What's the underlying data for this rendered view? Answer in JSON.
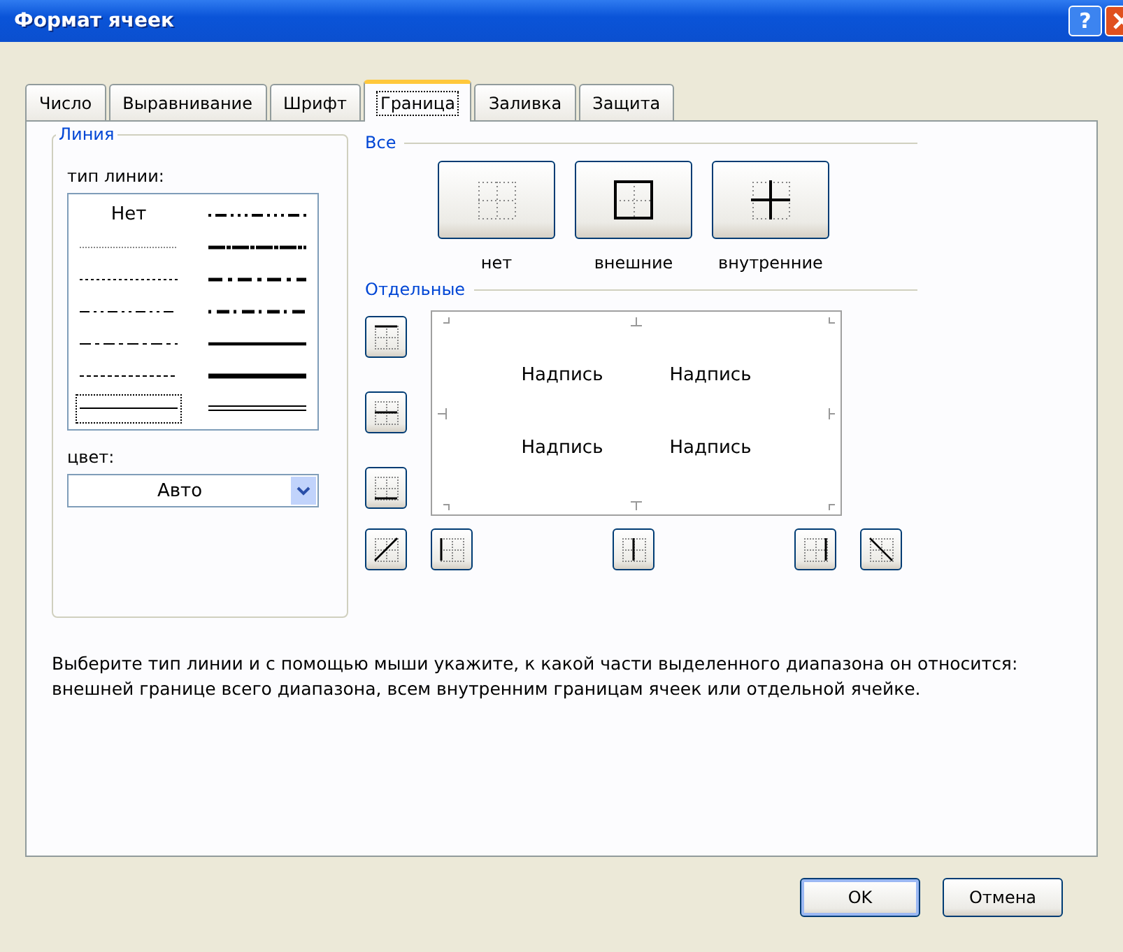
{
  "window": {
    "title": "Формат ячеек",
    "help_button": "?"
  },
  "tabs": [
    {
      "label": "Число",
      "selected": false
    },
    {
      "label": "Выравнивание",
      "selected": false
    },
    {
      "label": "Шрифт",
      "selected": false
    },
    {
      "label": "Граница",
      "selected": true
    },
    {
      "label": "Заливка",
      "selected": false
    },
    {
      "label": "Защита",
      "selected": false
    }
  ],
  "line_group": {
    "title": "Линия",
    "style_label": "тип линии:",
    "styles": [
      {
        "kind": "none",
        "label": "Нет",
        "selected": false
      },
      {
        "kind": "hair",
        "selected": false
      },
      {
        "kind": "dotted",
        "selected": false
      },
      {
        "kind": "dashdotdot",
        "selected": false
      },
      {
        "kind": "dashdot",
        "selected": false
      },
      {
        "kind": "dashed",
        "selected": false
      },
      {
        "kind": "thin",
        "selected": true
      },
      {
        "kind": "medium-dashdotdot",
        "selected": false
      },
      {
        "kind": "slant-dashdot",
        "selected": false
      },
      {
        "kind": "medium-dashdot",
        "selected": false
      },
      {
        "kind": "medium-dashed",
        "selected": false
      },
      {
        "kind": "medium",
        "selected": false
      },
      {
        "kind": "thick",
        "selected": false
      },
      {
        "kind": "double",
        "selected": false
      }
    ],
    "color_label": "цвет:",
    "color_value": "Авто"
  },
  "presets": {
    "title": "Все",
    "buttons": [
      {
        "kind": "none",
        "label": "нет"
      },
      {
        "kind": "outline",
        "label": "внешние"
      },
      {
        "kind": "inside",
        "label": "внутренние"
      }
    ]
  },
  "individual": {
    "title": "Отдельные",
    "preview_texts": [
      "Надпись",
      "Надпись",
      "Надпись",
      "Надпись"
    ],
    "side_buttons": [
      {
        "kind": "top"
      },
      {
        "kind": "middle"
      },
      {
        "kind": "bottom"
      },
      {
        "kind": "diag-up"
      }
    ],
    "bottom_buttons": [
      {
        "kind": "left"
      },
      {
        "kind": "center"
      },
      {
        "kind": "right"
      },
      {
        "kind": "diag-down"
      }
    ]
  },
  "description": "Выберите тип линии и с помощью мыши укажите, к какой части выделенного диапазона он относится: внешней границе всего диапазона, всем внутренним границам ячеек или отдельной ячейке.",
  "buttons": [
    "OK",
    "Отмена"
  ]
}
